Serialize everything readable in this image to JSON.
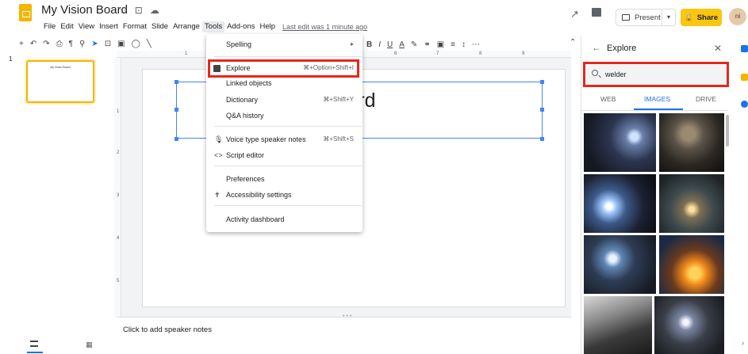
{
  "document": {
    "title": "My Vision Board",
    "last_edit": "Last edit was 1 minute ago"
  },
  "menubar": [
    "File",
    "Edit",
    "View",
    "Insert",
    "Format",
    "Slide",
    "Arrange",
    "Tools",
    "Add-ons",
    "Help"
  ],
  "header": {
    "present_label": "Present",
    "share_label": "Share",
    "avatar_initials": "ni"
  },
  "toolbar": {
    "text_format_buttons": [
      "B",
      "I",
      "U",
      "A"
    ],
    "more": "⋯"
  },
  "filmstrip": {
    "slide_number": "1",
    "thumb_title": "My Vision Board"
  },
  "slide": {
    "title_visible": "n Board"
  },
  "ruler": {
    "h_numbers": [
      "1",
      "6",
      "7",
      "8",
      "9"
    ],
    "v_numbers": [
      "1",
      "2",
      "3",
      "4",
      "5"
    ]
  },
  "notes": {
    "placeholder": "Click to add speaker notes"
  },
  "tools_menu": {
    "items": [
      {
        "label": "Spelling",
        "shortcut": "▸"
      },
      {
        "label": "Explore",
        "shortcut": "⌘+Option+Shift+I"
      },
      {
        "label": "Linked objects",
        "shortcut": ""
      },
      {
        "label": "Dictionary",
        "shortcut": "⌘+Shift+Y"
      },
      {
        "label": "Q&A history",
        "shortcut": ""
      },
      {
        "label": "Voice type speaker notes",
        "shortcut": "⌘+Shift+S"
      },
      {
        "label": "Script editor",
        "shortcut": ""
      },
      {
        "label": "Preferences",
        "shortcut": ""
      },
      {
        "label": "Accessibility settings",
        "shortcut": ""
      },
      {
        "label": "Activity dashboard",
        "shortcut": ""
      }
    ]
  },
  "explore": {
    "title": "Explore",
    "search_value": "welder",
    "tabs": [
      "WEB",
      "IMAGES",
      "DRIVE"
    ],
    "active_tab": "IMAGES"
  },
  "colors": {
    "accent": "#1a73e8",
    "slides_yellow": "#f4b400",
    "share_yellow": "#f9c80e",
    "highlight_red": "#e7271b"
  },
  "icons": [
    "star-icon",
    "folder-icon",
    "cloud-icon",
    "trend-icon",
    "comment-icon",
    "present-icon",
    "lock-icon",
    "search-icon",
    "back-arrow-icon",
    "close-icon",
    "mic-icon",
    "code-icon",
    "accessibility-icon",
    "explore-icon"
  ]
}
